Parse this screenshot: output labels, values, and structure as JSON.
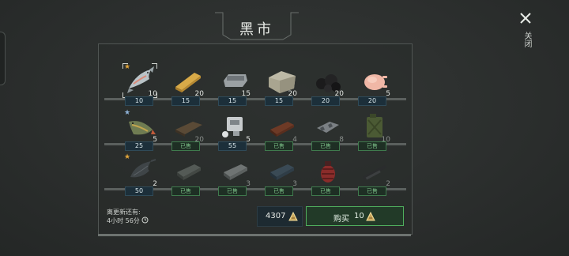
{
  "title": "黑市",
  "close_label": "关闭",
  "rows": [
    {
      "items": [
        {
          "icon": "salmon-fish-icon",
          "qty": "10",
          "price": "10",
          "star": "gold",
          "selected": true
        },
        {
          "icon": "wood-plank-icon",
          "qty": "20",
          "price": "15"
        },
        {
          "icon": "steel-ingot-icon",
          "qty": "15",
          "price": "15"
        },
        {
          "icon": "stone-block-icon",
          "qty": "20",
          "price": "15"
        },
        {
          "icon": "coal-icon",
          "qty": "20",
          "price": "20"
        },
        {
          "icon": "raw-chicken-icon",
          "qty": "5",
          "price": "20"
        }
      ]
    },
    {
      "items": [
        {
          "icon": "pike-fish-icon",
          "qty": "5",
          "price": "25",
          "star": "blue"
        },
        {
          "icon": "dark-plank-icon",
          "qty": "20",
          "sold": "已售"
        },
        {
          "icon": "engine-part-icon",
          "qty": "5",
          "price": "55"
        },
        {
          "icon": "copper-ingot-icon",
          "qty": "4",
          "sold": "已售"
        },
        {
          "icon": "metal-scrap-icon",
          "qty": "8",
          "sold": "已售"
        },
        {
          "icon": "jerrycan-icon",
          "qty": "10",
          "sold": "已售"
        }
      ]
    },
    {
      "items": [
        {
          "icon": "catfish-icon",
          "qty": "2",
          "price": "50",
          "star": "gold"
        },
        {
          "icon": "iron-ingot-icon",
          "qty": "",
          "sold": "已售"
        },
        {
          "icon": "silver-ingot-icon",
          "qty": "3",
          "sold": "已售"
        },
        {
          "icon": "blue-ingot-icon",
          "qty": "3",
          "sold": "已售"
        },
        {
          "icon": "grenade-icon",
          "qty": "",
          "sold": "已售"
        },
        {
          "icon": "rifle-parts-icon",
          "qty": "2",
          "sold": "已售"
        }
      ]
    }
  ],
  "refresh": {
    "line1": "离更新还有:",
    "line2": "4小时 56分"
  },
  "currency": {
    "amount": "4307"
  },
  "buy": {
    "label": "购买",
    "count": "10"
  },
  "colors": {
    "accent_green": "#4fae5d",
    "price_bg": "#1c2f3a",
    "star_gold": "#e0a43a",
    "star_blue": "#8fb3d8"
  }
}
